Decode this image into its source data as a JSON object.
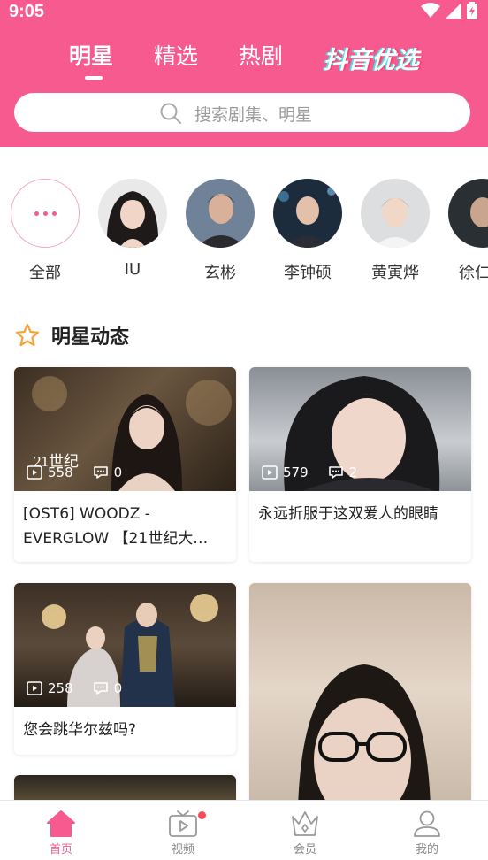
{
  "status_bar": {
    "time": "9:05"
  },
  "top_tabs": [
    "明星",
    "精选",
    "热剧",
    "抖音优选"
  ],
  "search": {
    "placeholder": "搜索剧集、明星"
  },
  "stars": [
    {
      "name": "全部"
    },
    {
      "name": "IU"
    },
    {
      "name": "玄彬"
    },
    {
      "name": "李钟硕"
    },
    {
      "name": "黄寅烨"
    },
    {
      "name": "徐仁国"
    }
  ],
  "section": {
    "title": "明星动态"
  },
  "cards": [
    {
      "title": "[OST6] WOODZ - EVERGLOW 【21世纪大…",
      "views": "558",
      "comments": "0",
      "overlay": "21世纪"
    },
    {
      "title": "永远折服于这双爱人的眼睛",
      "views": "579",
      "comments": "2"
    },
    {
      "title": "您会跳华尔兹吗?",
      "views": "258",
      "comments": "0"
    },
    {
      "title": ""
    }
  ],
  "bottom_nav": [
    {
      "label": "首页",
      "active": true
    },
    {
      "label": "视频"
    },
    {
      "label": "会员"
    },
    {
      "label": "我的"
    }
  ],
  "colors": {
    "brand_pink": "#f75a8f",
    "accent_orange": "#f7a23b",
    "badge_red": "#f44b57"
  }
}
